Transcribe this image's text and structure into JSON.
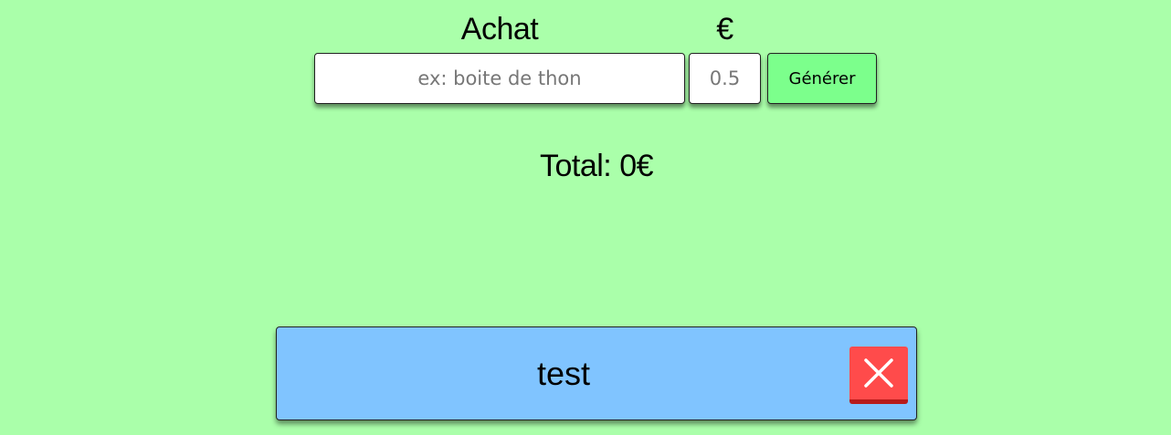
{
  "header": {
    "achat_label": "Achat",
    "currency_label": "€"
  },
  "form": {
    "name_placeholder": "ex: boite de thon",
    "price_placeholder": "0.5",
    "generate_label": "Générer"
  },
  "total": {
    "text": "Total: 0€"
  },
  "items": [
    {
      "name": "test"
    }
  ],
  "colors": {
    "background": "#aaffaa",
    "generate_button": "#7cff8c",
    "item_card": "#80c4ff",
    "delete_button": "#ff4b4b"
  },
  "icons": {
    "delete": "close-icon"
  }
}
